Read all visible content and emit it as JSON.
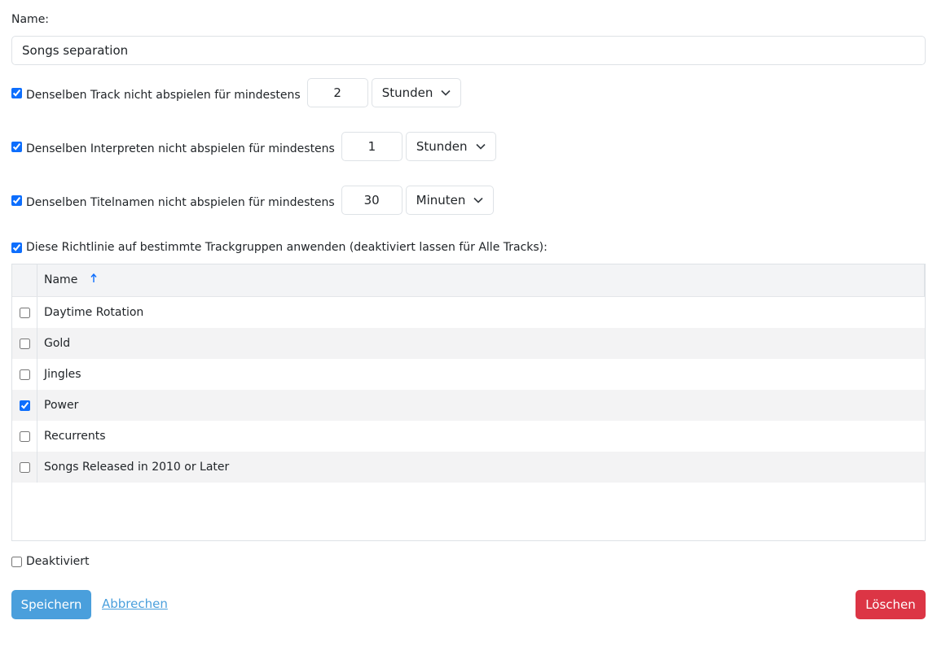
{
  "form": {
    "name_label": "Name:",
    "name_value": "Songs separation"
  },
  "rules": [
    {
      "label": "Denselben Track nicht abspielen für mindestens",
      "checked": true,
      "value": "2",
      "unit": "Stunden"
    },
    {
      "label": "Denselben Interpreten nicht abspielen für mindestens",
      "checked": true,
      "value": "1",
      "unit": "Stunden"
    },
    {
      "label": "Denselben Titelnamen nicht abspielen für mindestens",
      "checked": true,
      "value": "30",
      "unit": "Minuten"
    }
  ],
  "groups": {
    "label": "Diese Richtlinie auf bestimmte Trackgruppen anwenden (deaktiviert lassen für Alle Tracks):",
    "checked": true,
    "column_header": "Name",
    "sort_icon": "sort-ascending-arrow",
    "rows": [
      {
        "name": "Daytime Rotation",
        "checked": false
      },
      {
        "name": "Gold",
        "checked": false
      },
      {
        "name": "Jingles",
        "checked": false
      },
      {
        "name": "Power",
        "checked": true
      },
      {
        "name": "Recurrents",
        "checked": false
      },
      {
        "name": "Songs Released in 2010 or Later",
        "checked": false
      }
    ]
  },
  "disabled": {
    "label": "Deaktiviert",
    "checked": false
  },
  "actions": {
    "save_label": "Speichern",
    "cancel_label": "Abbrechen",
    "delete_label": "Löschen"
  },
  "colors": {
    "primary": "#4a9fdc",
    "danger": "#dc3545",
    "accent": "#0d6efd"
  }
}
